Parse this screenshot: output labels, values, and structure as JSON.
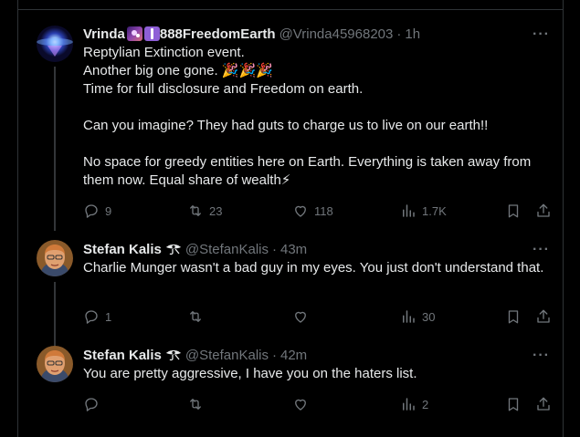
{
  "tweets": [
    {
      "name": "Vrinda",
      "handle": "@Vrinda45968203",
      "time": "1h",
      "name_suffix": "888FreedomEarth",
      "text": "Reptylian Extinction event.\nAnother big one gone. 🎉🎉🎉\nTime for full disclosure and Freedom on earth.\n\nCan you imagine? They had guts to charge us to live on our earth!!\n\nNo space for greedy entities here on Earth. Everything is taken away from them now. Equal share of wealth⚡",
      "replies": "9",
      "reposts": "23",
      "likes": "118",
      "views": "1.7K"
    },
    {
      "name": "Stefan Kalis",
      "handle": "@StefanKalis",
      "time": "43m",
      "text": "Charlie Munger wasn't a bad guy in my eyes. You just don't understand that.",
      "replies": "1",
      "reposts": "",
      "likes": "",
      "views": "30"
    },
    {
      "name": "Stefan Kalis",
      "handle": "@StefanKalis",
      "time": "42m",
      "text": "You are pretty aggressive, I have you on the haters list.",
      "replies": "",
      "reposts": "",
      "likes": "",
      "views": "2"
    }
  ],
  "more_label": "···",
  "dot": "·",
  "icons": {
    "reply": "reply-icon",
    "repost": "repost-icon",
    "like": "heart-icon",
    "views": "views-icon",
    "bookmark": "bookmark-icon",
    "share": "share-icon",
    "more": "more-icon"
  },
  "colors": {
    "background": "#000000",
    "text": "#e7e9ea",
    "muted": "#71767b",
    "border": "#2f3336"
  }
}
